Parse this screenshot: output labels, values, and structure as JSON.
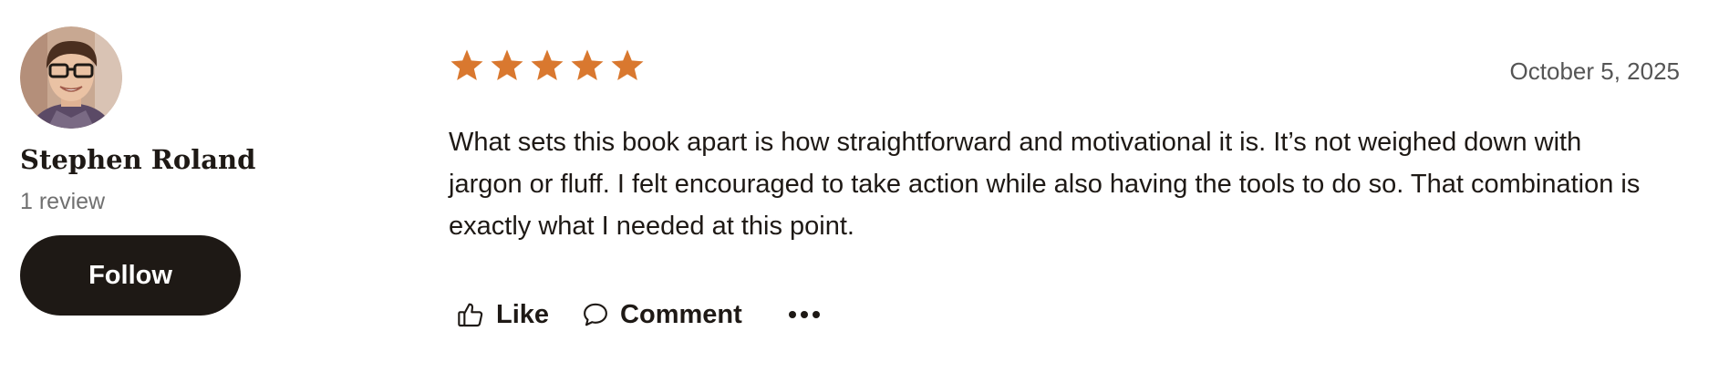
{
  "reviewer": {
    "name": "Stephen Roland",
    "review_count": "1 review",
    "follow_label": "Follow"
  },
  "review": {
    "rating": 5,
    "rating_max": 5,
    "star_color": "#D9782F",
    "date": "October 5, 2025",
    "text": "What sets this book apart is how straightforward and motivational it is. It’s not weighed down with jargon or fluff. I felt encouraged to take action while also having the tools to do so. That combination is exactly what I needed at this point."
  },
  "actions": {
    "like_label": "Like",
    "comment_label": "Comment",
    "like_icon": "thumbs-up-icon",
    "comment_icon": "speech-bubble-icon",
    "more_icon": "more-dots-icon"
  },
  "colors": {
    "text_primary": "#1E1915",
    "text_secondary": "#707070",
    "button_bg": "#1E1915",
    "button_text": "#FFFFFF"
  }
}
